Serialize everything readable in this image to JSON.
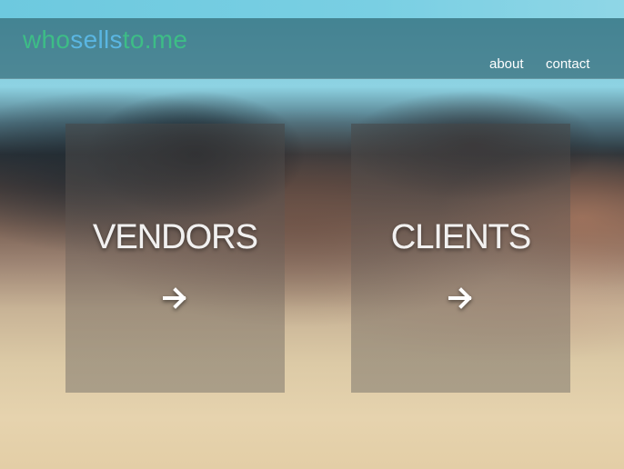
{
  "header": {
    "logo_part1": "who",
    "logo_part2": "sells",
    "logo_part3": "to.me",
    "nav": [
      {
        "label": "about"
      },
      {
        "label": "contact"
      }
    ]
  },
  "cards": [
    {
      "label": "VENDORS",
      "icon": "arrow-right-icon"
    },
    {
      "label": "CLIENTS",
      "icon": "arrow-right-icon"
    }
  ],
  "colors": {
    "logo_green": "#3dbd86",
    "logo_blue": "#5ab6e2",
    "header_bg": "#1c4a58",
    "top_strip": "#6dc9df"
  }
}
